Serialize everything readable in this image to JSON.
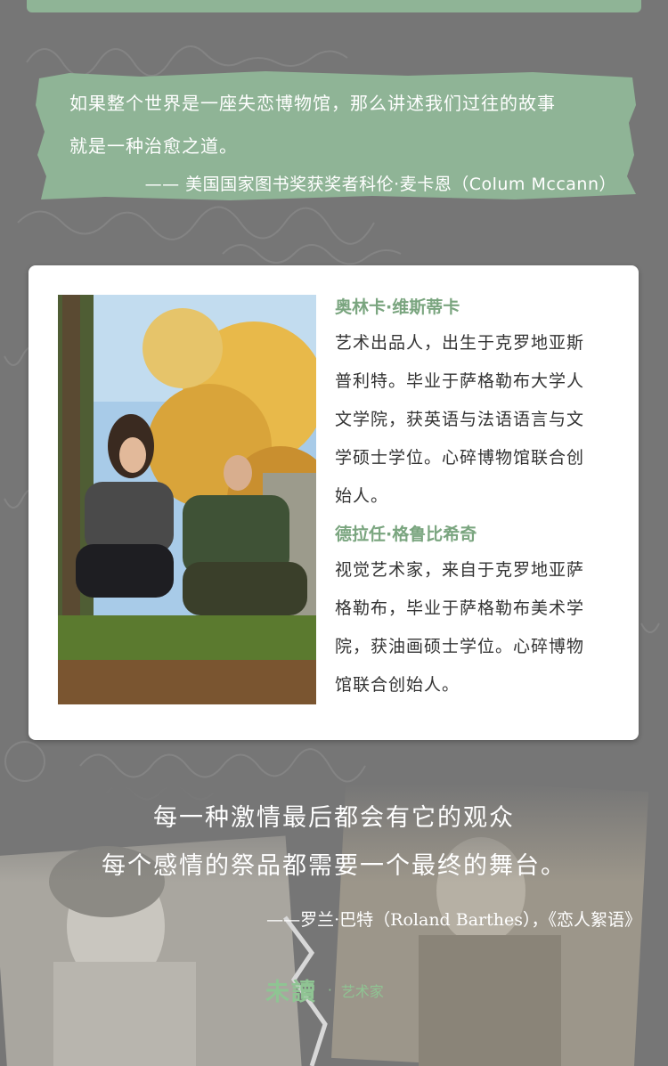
{
  "quote_banner": {
    "line1": "如果整个世界是一座失恋博物馆，那么讲述我们过往的故事",
    "line2": "就是一种治愈之道。",
    "attribution": "—— 美国国家图书奖获奖者科伦·麦卡恩（Colum Mccann）"
  },
  "profiles": [
    {
      "name": "奥林卡·维斯蒂卡",
      "bio_lines": [
        "艺术出品人，出生于克罗地亚斯",
        "普利特。毕业于萨格勒布大学人",
        "文学院，获英语与法语语言与文",
        "学硕士学位。心碎博物馆联合创",
        "始人。"
      ]
    },
    {
      "name": "德拉任·格鲁比希奇",
      "bio_lines": [
        "视觉艺术家，来自于克罗地亚萨",
        "格勒布，毕业于萨格勒布美术学",
        "院，获油画硕士学位。心碎博物",
        "馆联合创始人。"
      ]
    }
  ],
  "bottom_quote": {
    "line1": "每一种激情最后都会有它的观众",
    "line2": "每个感情的祭品都需要一个最终的舞台。",
    "attribution": "——罗兰·巴特（Roland Barthes），《恋人絮语》"
  },
  "brand": {
    "logo": "未讀",
    "separator": "·",
    "tagline": "艺术家"
  },
  "colors": {
    "background": "#767676",
    "banner_green": "#8fb496",
    "name_green": "#7aa57f",
    "brand_green": "#8fc493"
  }
}
